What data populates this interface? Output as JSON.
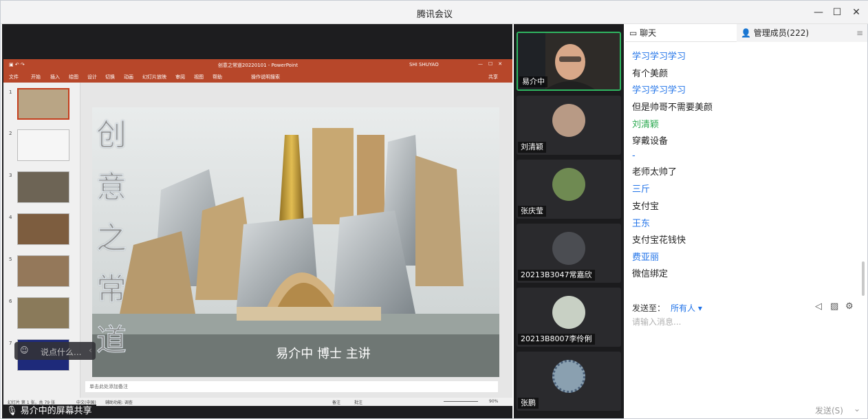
{
  "window": {
    "title": "腾讯会议"
  },
  "ppt": {
    "file_title": "创意之常道20220101 - PowerPoint",
    "user": "SHI SHUYAO",
    "ribbon": [
      "文件",
      "开始",
      "插入",
      "绘图",
      "设计",
      "切换",
      "动画",
      "幻灯片放映",
      "审阅",
      "视图",
      "帮助",
      "操作说明搜索"
    ],
    "share_label": "共享",
    "thumb_numbers": [
      "1",
      "2",
      "3",
      "4",
      "5",
      "6",
      "7"
    ],
    "slide_chars": [
      "创",
      "意",
      "之",
      "常",
      "道"
    ],
    "presenter_line": "易介中 博士 主讲",
    "notes_placeholder": "单击此处添加备注",
    "status": {
      "slide_info": "幻灯片 第 1 张，共 79 张",
      "lang": "中文(中国)",
      "accessibility": "辅助功能: 调查",
      "notes": "备注",
      "comments": "批注",
      "zoom": "90%"
    }
  },
  "float_chat": {
    "placeholder": "说点什么..."
  },
  "screen_share": {
    "label": "易介中的屏幕共享"
  },
  "video_tiles": [
    {
      "name": "易介中",
      "active": true
    },
    {
      "name": "刘清颖",
      "active": false
    },
    {
      "name": "张庆莹",
      "active": false
    },
    {
      "name": "20213B3047常嘉欣",
      "active": false
    },
    {
      "name": "20213B8007李伶俐",
      "active": false
    },
    {
      "name": "张鹏",
      "active": false
    }
  ],
  "chat": {
    "tab_chat": "聊天",
    "tab_members": "管理成员(222)",
    "messages": [
      {
        "text": "学习学习学习",
        "style": "name"
      },
      {
        "text": "有个美颜",
        "style": "body"
      },
      {
        "text": "学习学习学习",
        "style": "name"
      },
      {
        "text": "但是帅哥不需要美颜",
        "style": "body"
      },
      {
        "text": "刘清颖",
        "style": "green"
      },
      {
        "text": "穿戴设备",
        "style": "body"
      },
      {
        "text": "-",
        "style": "name"
      },
      {
        "text": "老师太帅了",
        "style": "body"
      },
      {
        "text": "三斤",
        "style": "name"
      },
      {
        "text": "支付宝",
        "style": "body"
      },
      {
        "text": "王东",
        "style": "name"
      },
      {
        "text": "支付宝花钱快",
        "style": "body"
      },
      {
        "text": "费亚丽",
        "style": "name"
      },
      {
        "text": "微信绑定",
        "style": "body"
      }
    ],
    "send_to_label": "发送至：",
    "send_to_value": "所有人",
    "input_placeholder": "请输入消息...",
    "send_button": "发送(S)"
  },
  "colors": {
    "accent_blue": "#1f72e8",
    "ppt_red": "#b7472a",
    "active_green": "#2fb761"
  }
}
